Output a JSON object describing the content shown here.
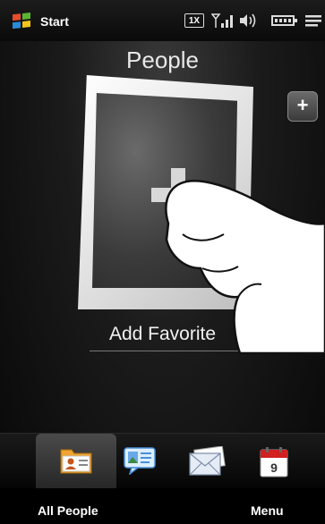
{
  "status_bar": {
    "start_label": "Start",
    "network_badge": "1X",
    "icons": [
      "windows-flag-icon",
      "network-1x-icon",
      "signal-strength-icon",
      "volume-icon",
      "battery-icon",
      "menu-lines-icon"
    ]
  },
  "page": {
    "title": "People",
    "favorite_label": "Add Favorite",
    "small_add_symbol": "+"
  },
  "tabs": [
    {
      "name": "all-people",
      "icon": "contact-card-icon",
      "selected": true
    },
    {
      "name": "messages",
      "icon": "photo-message-icon",
      "selected": false
    },
    {
      "name": "email",
      "icon": "envelope-icon",
      "selected": false
    },
    {
      "name": "calendar",
      "icon": "calendar-icon",
      "selected": false,
      "day": "9"
    }
  ],
  "softkeys": {
    "left": "All People",
    "right": "Menu"
  },
  "colors": {
    "background": "#000000",
    "card_frame": "#e6e6e6",
    "accent_green": "#3aa83a",
    "calendar_red": "#d02020"
  }
}
